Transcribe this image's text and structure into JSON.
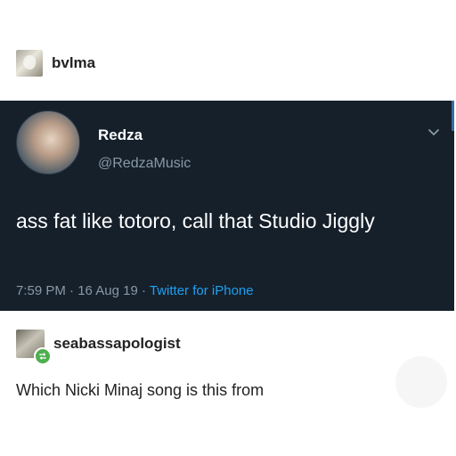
{
  "post": {
    "username": "bvlma"
  },
  "tweet": {
    "display_name": "Redza",
    "handle": "@RedzaMusic",
    "text": "ass fat like totoro, call that Studio Jiggly",
    "time": "7:59 PM",
    "date": "16 Aug 19",
    "source": "Twitter for iPhone",
    "separator": "·"
  },
  "reply": {
    "username": "seabassapologist",
    "text": "Which Nicki Minaj song is this from"
  },
  "colors": {
    "tweet_bg": "#15202b",
    "tweet_secondary": "#8899a6",
    "link_blue": "#1da1f2",
    "reblog_green": "#4caf50"
  }
}
